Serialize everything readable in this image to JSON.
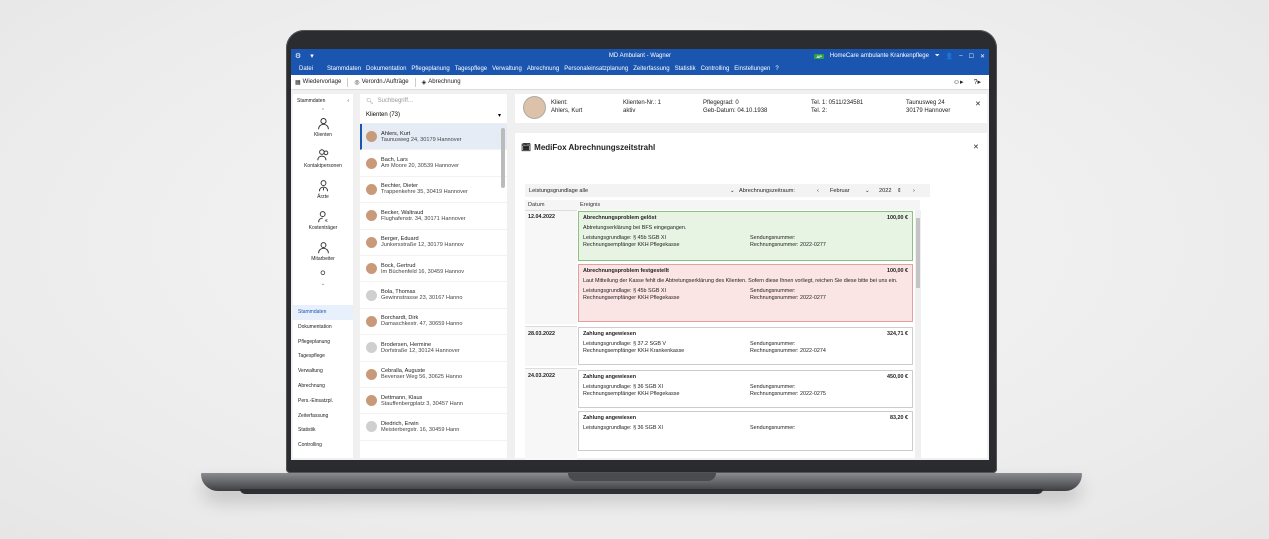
{
  "window": {
    "title": "MD Ambulant - Wagner",
    "badge": "AP",
    "org": "HomeCare ambulante Krankenpflege"
  },
  "menu": [
    "Datei",
    "Stammdaten",
    "Dokumentation",
    "Pflegeplanung",
    "Tagespflege",
    "Verwaltung",
    "Abrechnung",
    "Personaleinsatzplanung",
    "Zeiterfassung",
    "Statistik",
    "Controlling",
    "Einstellungen",
    "?"
  ],
  "toolbar": {
    "wiedervorlage": "Wiedervorlage",
    "verordn": "Verordn./Aufträge",
    "abrechnung": "Abrechnung"
  },
  "leftnav": {
    "header": "Stammdaten",
    "icons": [
      {
        "label": "Klienten",
        "icon": "person-icon"
      },
      {
        "label": "Kontaktpersonen",
        "icon": "contacts-icon"
      },
      {
        "label": "Ärzte",
        "icon": "doctor-icon"
      },
      {
        "label": "Kostenträger",
        "icon": "payer-icon"
      },
      {
        "label": "Mitarbeiter",
        "icon": "staff-icon"
      }
    ],
    "items": [
      "Stammdaten",
      "Dokumentation",
      "Pflegeplanung",
      "Tagespflege",
      "Verwaltung",
      "Abrechnung",
      "Pers.-Einsatzpl.",
      "Zeiterfassung",
      "Statistik",
      "Controlling"
    ]
  },
  "clients": {
    "search_placeholder": "Suchbegriff...",
    "header": "Klienten (73)",
    "rows": [
      {
        "name": "Ahlers, Kurt",
        "address": "Taunusweg 24, 30179 Hannover"
      },
      {
        "name": "Bach, Lars",
        "address": "Am Moore 20, 30539 Hannover"
      },
      {
        "name": "Bechter, Dieter",
        "address": "Trappenkehre 35, 30419 Hannover"
      },
      {
        "name": "Becker, Waltraud",
        "address": "Flughafenstr. 34, 30171 Hannover"
      },
      {
        "name": "Berger, Eduard",
        "address": "Junkersstraße 12, 30179 Hannov"
      },
      {
        "name": "Bock, Gertrud",
        "address": "Im Büchenfeld 16, 30459 Hannov"
      },
      {
        "name": "Bola, Thomas",
        "address": "Gewinnstrasse 23, 30167 Hanno"
      },
      {
        "name": "Borchardt, Dirk",
        "address": "Damaschkestr. 47, 30659 Hanno"
      },
      {
        "name": "Brodersen, Hermine",
        "address": "Dorfstraße 12, 30124 Hannover"
      },
      {
        "name": "Cebralla, Auguste",
        "address": "Bevenser Weg 56, 30625 Hanno"
      },
      {
        "name": "Dettmann, Klaus",
        "address": "Stauffenbergplatz 3, 30457 Hann"
      },
      {
        "name": "Diedrich, Erwin",
        "address": "Meisterbergstr. 16, 30459 Hann"
      }
    ]
  },
  "client_header": {
    "k_label": "Klient:",
    "k_name": "Ahlers, Kurt",
    "nr_label": "Klienten-Nr.: 1",
    "nr_status": "aktiv",
    "pg": "Pflegegrad: 0",
    "geb": "Geb-Datum: 04.10.1938",
    "tel1": "Tel. 1: 0511/234581",
    "tel2": "Tel. 2:",
    "street": "Taunusweg 24",
    "city": "30179 Hannover"
  },
  "timeline": {
    "title": "MediFox Abrechnungszeitstrahl",
    "filter": "Leistungsgrundlage alle",
    "zeitraum_label": "Abrechnungszeitraum:",
    "month": "Februar",
    "year": "2022",
    "col_date": "Datum",
    "col_event": "Ereignis",
    "labels": {
      "lg": "Leistungsgrundlage:",
      "re": "Rechnungsempfänger",
      "sn": "Sendungsnummer:",
      "rn": "Rechnungsnummer:"
    },
    "dates": [
      "12.04.2022",
      "28.03.2022",
      "24.03.2022"
    ],
    "events": [
      {
        "title": "Abrechnungsproblem gelöst",
        "amount": "100,00 €",
        "desc": "Abtretungserklärung bei BFS eingegangen.",
        "lg": "§ 45b SGB XI",
        "re": "KKH Pflegekasse",
        "rn": "2022-0277"
      },
      {
        "title": "Abrechnungsproblem festgestellt",
        "amount": "100,00 €",
        "desc": "Laut Mitteilung der Kasse fehlt die Abtretungserklärung des Klienten. Sofern diese Ihnen vorliegt, reichen Sie diese bitte bei uns ein.",
        "lg": "§ 45b SGB XI",
        "re": "KKH Pflegekasse",
        "rn": "2022-0277"
      },
      {
        "title": "Zahlung angewiesen",
        "amount": "324,71 €",
        "lg": "§ 37.2 SGB V",
        "re": "KKH Krankenkasse",
        "rn": "2022-0274"
      },
      {
        "title": "Zahlung angewiesen",
        "amount": "450,00 €",
        "lg": "§ 36 SGB XI",
        "re": "KKH Pflegekasse",
        "rn": "2022-0275"
      },
      {
        "title": "Zahlung angewiesen",
        "amount": "83,20 €",
        "lg": "§ 36 SGB XI"
      }
    ]
  },
  "colors": {
    "accent": "#1a55b0",
    "green": "#e7f4e3",
    "red": "#fbe5e4"
  }
}
